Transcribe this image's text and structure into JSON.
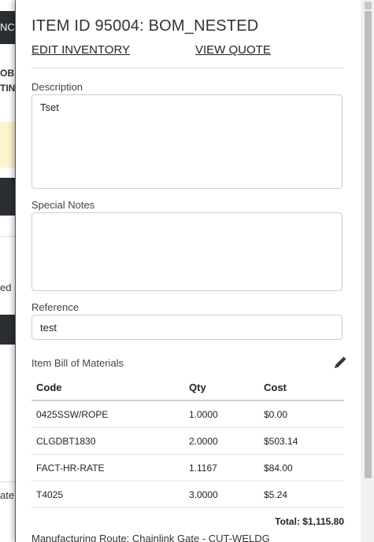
{
  "background": {
    "nav_fragment": "NC",
    "fragment_a_line1": "OB",
    "fragment_a_line2": "TIN",
    "fragment_b": "ed",
    "fragment_c": "ate"
  },
  "drawer": {
    "title": "ITEM ID 95004: BOM_NESTED",
    "links": {
      "edit_inventory": "EDIT INVENTORY",
      "view_quote": "VIEW QUOTE"
    },
    "description": {
      "label": "Description",
      "value": "Tset"
    },
    "special_notes": {
      "label": "Special Notes",
      "value": ""
    },
    "reference": {
      "label": "Reference",
      "value": "test"
    },
    "bom": {
      "label": "Item Bill of Materials",
      "edit_icon": "pencil-icon",
      "columns": [
        "Code",
        "Qty",
        "Cost"
      ],
      "rows": [
        {
          "code": "0425SSW/ROPE",
          "qty": "1.0000",
          "cost": "$0.00"
        },
        {
          "code": "CLGDBT1830",
          "qty": "2.0000",
          "cost": "$503.14"
        },
        {
          "code": "FACT-HR-RATE",
          "qty": "1.1167",
          "cost": "$84.00"
        },
        {
          "code": "T4025",
          "qty": "3.0000",
          "cost": "$5.24"
        }
      ],
      "total_label": "Total:",
      "total_value": "$1,115.80"
    },
    "manufacturing_route": "Manufacturing Route: Chainlink Gate - CUT-WELDG"
  },
  "colors": {
    "dark_nav": "#2b2f33",
    "warning_bg": "#fff3cd",
    "border": "#cfcfcf"
  }
}
